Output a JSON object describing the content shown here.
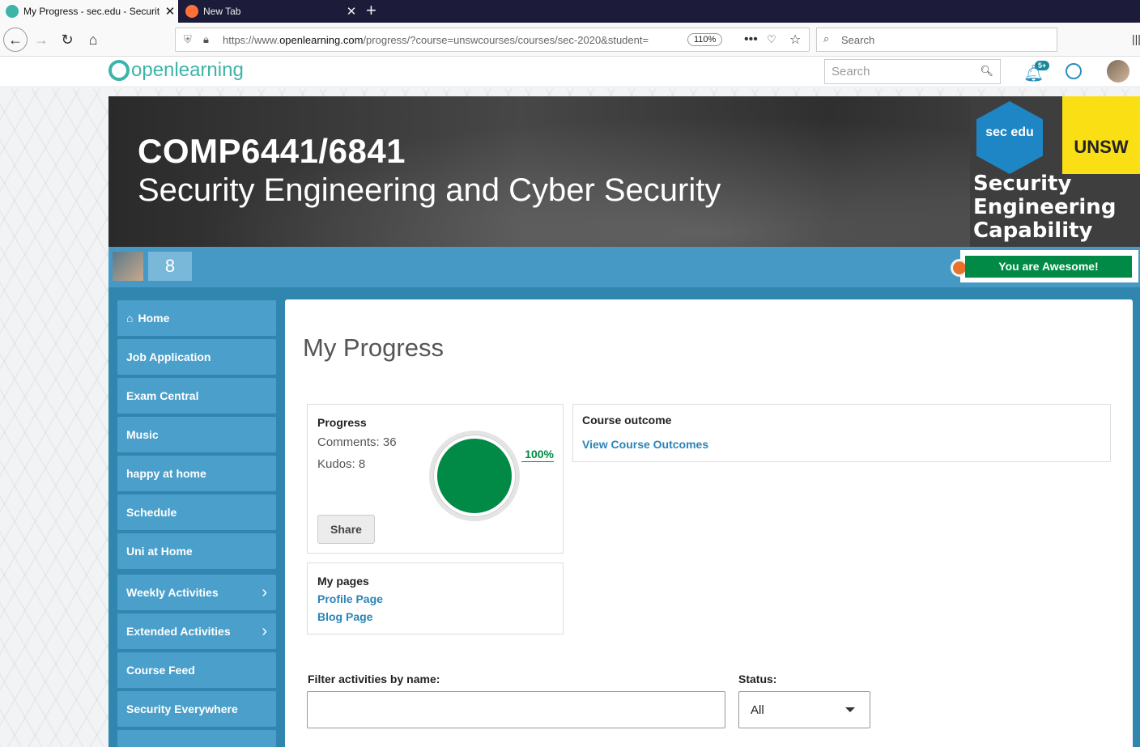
{
  "browser": {
    "tabs": [
      {
        "title": "My Progress - sec.edu - Securit",
        "active": true
      },
      {
        "title": "New Tab",
        "active": false
      }
    ],
    "url_prefix": "https://www.",
    "url_domain": "openlearning.com",
    "url_rest": "/progress/?course=unswcourses/courses/sec-2020&student=",
    "zoom": "110%",
    "search_placeholder": "Search"
  },
  "site": {
    "logo_text": "openlearning",
    "search_placeholder": "Search",
    "notification_badge": "5+"
  },
  "banner": {
    "course_code": "COMP6441/6841",
    "course_title": "Security Engineering and Cyber Security",
    "hex_text": "sec edu",
    "unsw_text": "UNSW",
    "brand_lines": [
      "Security",
      "Engineering",
      "Capability"
    ]
  },
  "profile_bar": {
    "score": "8",
    "award": "You are Awesome!"
  },
  "sidebar": {
    "items": [
      {
        "label": "Home",
        "icon": "home-icon"
      },
      {
        "label": "Job Application"
      },
      {
        "label": "Exam Central"
      },
      {
        "label": "Music"
      },
      {
        "label": "happy at home"
      },
      {
        "label": "Schedule"
      },
      {
        "label": "Uni at Home"
      },
      {
        "label": "Weekly Activities",
        "expandable": true
      },
      {
        "label": "Extended Activities",
        "expandable": true
      },
      {
        "label": "Course Feed"
      },
      {
        "label": "Security Everywhere"
      }
    ]
  },
  "main": {
    "title": "My Progress",
    "progress": {
      "header": "Progress",
      "comments": "Comments: 36",
      "kudos": "Kudos: 8",
      "percent_label": "100%",
      "percent_value": 100,
      "share_label": "Share"
    },
    "outcome": {
      "header": "Course outcome",
      "link": "View Course Outcomes"
    },
    "pages": {
      "header": "My pages",
      "links": [
        "Profile Page",
        "Blog Page"
      ]
    },
    "filter": {
      "name_label": "Filter activities by name:",
      "name_value": "",
      "status_label": "Status:",
      "status_value": "All"
    }
  },
  "colors": {
    "accent_blue": "#4799c5",
    "success_green": "#008a45",
    "link_blue": "#2a84b8",
    "brand_teal": "#3cb4a8"
  }
}
